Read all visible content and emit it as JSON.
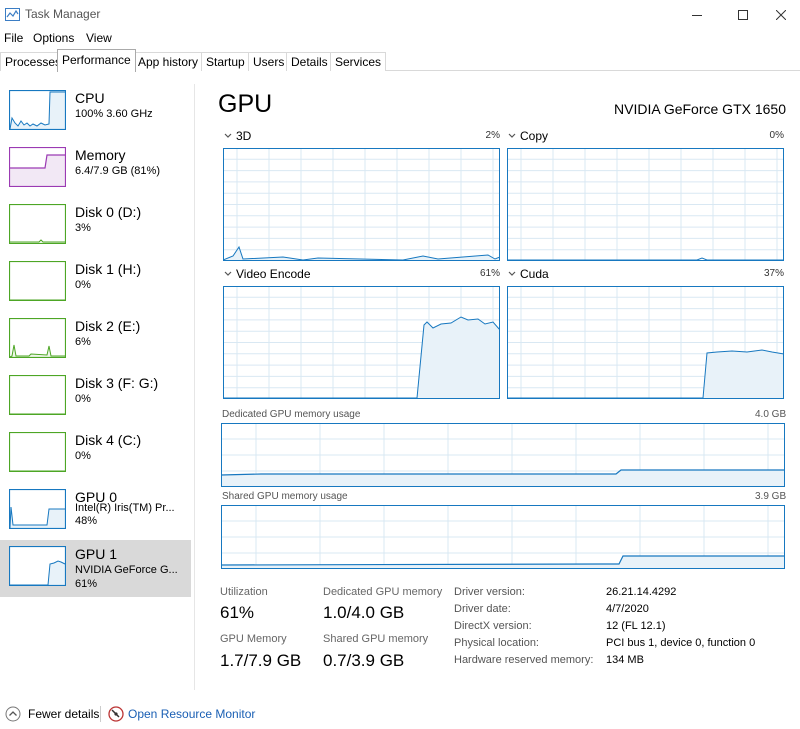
{
  "window": {
    "title": "Task Manager"
  },
  "menu": [
    "File",
    "Options",
    "View"
  ],
  "tabs": [
    "Processes",
    "Performance",
    "App history",
    "Startup",
    "Users",
    "Details",
    "Services"
  ],
  "sidebar": [
    {
      "name": "CPU",
      "sub1": "100% 3.60 GHz",
      "sub2": "",
      "color": "#1778c0",
      "fill": "#e8f2f9"
    },
    {
      "name": "Memory",
      "sub1": "6.4/7.9 GB (81%)",
      "sub2": "",
      "color": "#9b3ab3",
      "fill": "#f2e8f5"
    },
    {
      "name": "Disk 0 (D:)",
      "sub1": "3%",
      "sub2": "",
      "color": "#4da625",
      "fill": "#eef6e9"
    },
    {
      "name": "Disk 1 (H:)",
      "sub1": "0%",
      "sub2": "",
      "color": "#4da625",
      "fill": "#eef6e9"
    },
    {
      "name": "Disk 2 (E:)",
      "sub1": "6%",
      "sub2": "",
      "color": "#4da625",
      "fill": "#eef6e9"
    },
    {
      "name": "Disk 3 (F: G:)",
      "sub1": "0%",
      "sub2": "",
      "color": "#4da625",
      "fill": "#eef6e9"
    },
    {
      "name": "Disk 4 (C:)",
      "sub1": "0%",
      "sub2": "",
      "color": "#4da625",
      "fill": "#eef6e9"
    },
    {
      "name": "GPU 0",
      "sub1": "Intel(R) Iris(TM) Pr...",
      "sub2": "48%",
      "color": "#1778c0",
      "fill": "#e8f2f9"
    },
    {
      "name": "GPU 1",
      "sub1": "NVIDIA GeForce G...",
      "sub2": "61%",
      "color": "#1778c0",
      "fill": "#e8f2f9"
    }
  ],
  "main": {
    "title": "GPU",
    "model": "NVIDIA GeForce GTX 1650",
    "panels": [
      {
        "label": "3D",
        "pct": "2%"
      },
      {
        "label": "Copy",
        "pct": "0%"
      },
      {
        "label": "Video Encode",
        "pct": "61%"
      },
      {
        "label": "Cuda",
        "pct": "37%"
      }
    ],
    "dedicated_label": "Dedicated GPU memory usage",
    "dedicated_max": "4.0 GB",
    "shared_label": "Shared GPU memory usage",
    "shared_max": "3.9 GB",
    "stats": {
      "utilization_label": "Utilization",
      "utilization_value": "61%",
      "dedicated_label": "Dedicated GPU memory",
      "dedicated_value": "1.0/4.0 GB",
      "gpu_memory_label": "GPU Memory",
      "gpu_memory_value": "1.7/7.9 GB",
      "shared_label": "Shared GPU memory",
      "shared_value": "0.7/3.9 GB"
    },
    "info": [
      {
        "label": "Driver version:",
        "value": "26.21.14.4292"
      },
      {
        "label": "Driver date:",
        "value": "4/7/2020"
      },
      {
        "label": "DirectX version:",
        "value": "12 (FL 12.1)"
      },
      {
        "label": "Physical location:",
        "value": "PCI bus 1, device 0, function 0"
      },
      {
        "label": "Hardware reserved memory:",
        "value": "134 MB"
      }
    ]
  },
  "footer": {
    "fewer_details": "Fewer details",
    "resource_monitor": "Open Resource Monitor"
  },
  "colors": {
    "gpu_line": "#1778c0",
    "gpu_fill": "#e8f2f9",
    "grid": "#d9e8f3",
    "accent_link": "#1a5fb4"
  }
}
